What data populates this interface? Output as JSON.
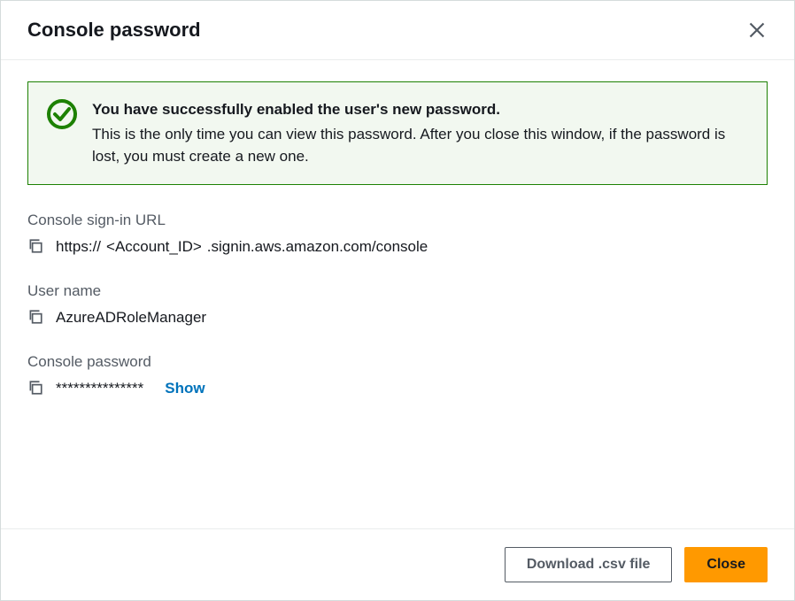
{
  "header": {
    "title": "Console password"
  },
  "alert": {
    "title": "You have successfully enabled the user's new password.",
    "body": "This is the only time you can view this password. After you close this window, if the password is lost, you must create a new one."
  },
  "fields": {
    "signin_url": {
      "label": "Console sign-in URL",
      "prefix": "https://",
      "placeholder": "<Account_ID>",
      "suffix": ".signin.aws.amazon.com/console"
    },
    "username": {
      "label": "User name",
      "value": "AzureADRoleManager"
    },
    "password": {
      "label": "Console password",
      "masked": "***************",
      "show_label": "Show"
    }
  },
  "footer": {
    "download_label": "Download .csv file",
    "close_label": "Close"
  }
}
